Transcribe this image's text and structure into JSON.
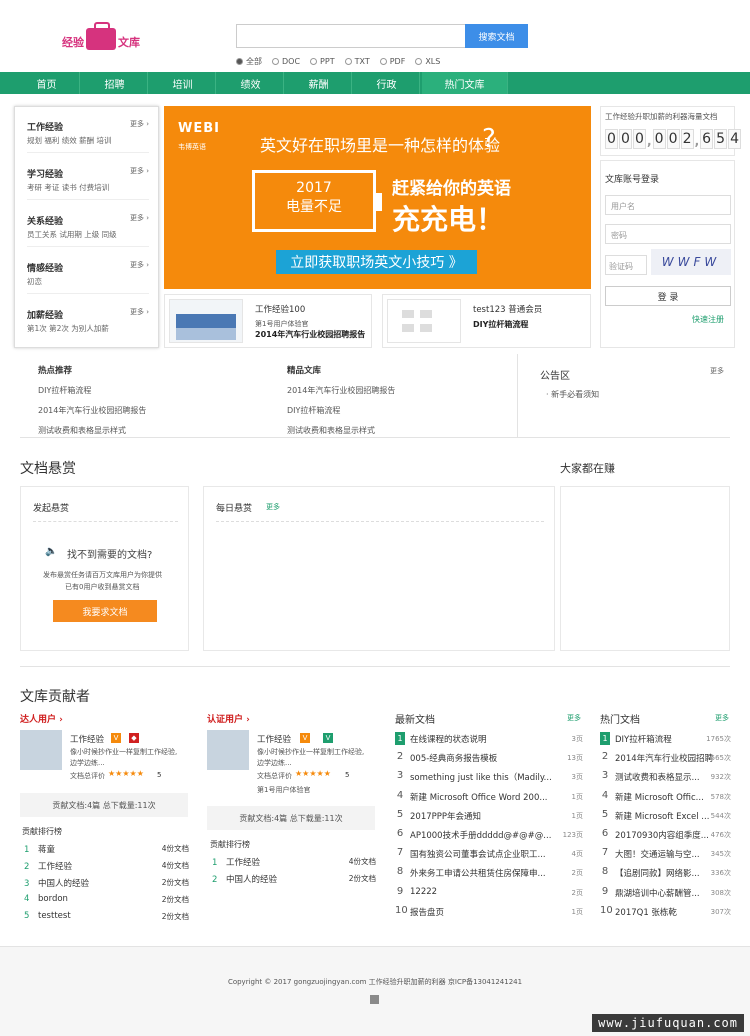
{
  "header": {
    "logo_left": "经验",
    "logo_right": "文库",
    "search_placeholder": "",
    "search_button": "搜索文档",
    "filters": [
      "全部",
      "DOC",
      "PPT",
      "TXT",
      "PDF",
      "XLS"
    ]
  },
  "nav": [
    "首页",
    "招聘",
    "培训",
    "绩效",
    "薪酬",
    "行政",
    "热门文库"
  ],
  "categories": [
    {
      "title": "工作经验",
      "more": "更多 ›",
      "links": "规划  福利  绩效  薪酬  培训"
    },
    {
      "title": "学习经验",
      "more": "更多 ›",
      "links": "考研  考证  读书  付费培训"
    },
    {
      "title": "关系经验",
      "more": "更多 ›",
      "links": "员工关系  试用期  上级  同级"
    },
    {
      "title": "情感经验",
      "more": "更多 ›",
      "links": "初恋"
    },
    {
      "title": "加薪经验",
      "more": "更多 ›",
      "links": "第1次  第2次  为别人加薪"
    }
  ],
  "banner": {
    "brand": "WEBI",
    "brand_sub": "韦博英语",
    "title": "英文好在职场里是一种怎样的体验",
    "year": "2017",
    "battery": "电量不足",
    "copy1": "赶紧给你的英语",
    "copy2": "充充电！",
    "cta": "立即获取职场英文小技巧 》"
  },
  "doc_cards": [
    {
      "user": "工作经验100",
      "desc": "第1号用户体验官",
      "title": "2014年汽车行业校园招聘报告"
    },
    {
      "user": "test123   普通会员",
      "desc": "",
      "title": "DIY拉杆箱流程"
    }
  ],
  "counter": {
    "label": "工作经验升职加薪的利器海量文档",
    "digits": [
      "0",
      "0",
      "0",
      "0",
      "0",
      "2",
      "6",
      "5",
      "4"
    ]
  },
  "login": {
    "title": "文库账号登录",
    "user_ph": "用户名",
    "pass_ph": "密码",
    "captcha_ph": "验证码",
    "captcha": "WWFW",
    "button": "登 录",
    "register": "快速注册"
  },
  "highlights": {
    "hot_title": "热点推荐",
    "hot": [
      "DIY拉杆箱流程",
      "2014年汽车行业校园招聘报告",
      "测试收费和表格显示样式"
    ],
    "best_title": "精品文库",
    "best": [
      "2014年汽车行业校园招聘报告",
      "DIY拉杆箱流程",
      "测试收费和表格显示样式"
    ],
    "notice_title": "公告区",
    "notice_more": "更多",
    "notice": "· 新手必看须知"
  },
  "bounty": {
    "title": "文档悬赏",
    "everyone": "大家都在赚",
    "post_title": "发起悬赏",
    "not_found": "找不到需要的文档?",
    "desc1": "发布悬赏任务请百万文库用户为你提供",
    "desc2": "已有0用户收到悬赏文档",
    "button": "我要求文档",
    "daily": "每日悬赏",
    "daily_more": "更多"
  },
  "contrib": {
    "title": "文库贡献者",
    "expert": {
      "tab": "达人用户 ›",
      "name": "工作经验",
      "bio1": "像小时候抄作业一样复制工作经验,",
      "bio2": "边学边练...",
      "rating_label": "文档总评价",
      "stars": "★★★★★",
      "rating": "5",
      "stats": "贡献文档:4篇   总下载量:11次",
      "rank_title": "贡献排行榜",
      "rank": [
        {
          "n": "1",
          "name": "蒋童",
          "v": "4份文档"
        },
        {
          "n": "2",
          "name": "工作经验",
          "v": "4份文档"
        },
        {
          "n": "3",
          "name": "中国人的经验",
          "v": "2份文档"
        },
        {
          "n": "4",
          "name": "bordon",
          "v": "2份文档"
        },
        {
          "n": "5",
          "name": "testtest",
          "v": "2份文档"
        }
      ]
    },
    "verified": {
      "tab": "认证用户 ›",
      "name": "工作经验",
      "bio1": "像小时候抄作业一样复制工作经验,",
      "bio2": "边学边练...",
      "rating_label": "文档总评价",
      "stars": "★★★★★",
      "rating": "5",
      "extra": "第1号用户体验官",
      "stats": "贡献文档:4篇   总下载量:11次",
      "rank_title": "贡献排行榜",
      "rank": [
        {
          "n": "1",
          "name": "工作经验",
          "v": "4份文档"
        },
        {
          "n": "2",
          "name": "中国人的经验",
          "v": "2份文档"
        }
      ]
    }
  },
  "latest": {
    "title": "最新文档",
    "more": "更多",
    "items": [
      {
        "n": "1",
        "t": "在线课程的状态说明",
        "v": "3页"
      },
      {
        "n": "2",
        "t": "005-经典商务报告模板",
        "v": "13页"
      },
      {
        "n": "3",
        "t": "something just like this（Madily...",
        "v": "3页"
      },
      {
        "n": "4",
        "t": "新建 Microsoft Office Word 200...",
        "v": "1页"
      },
      {
        "n": "5",
        "t": "2017PPP年会通知",
        "v": "1页"
      },
      {
        "n": "6",
        "t": "AP1000技术手册ddddd@#@#@...",
        "v": "123页"
      },
      {
        "n": "7",
        "t": "国有独资公司董事会试点企业职工...",
        "v": "4页"
      },
      {
        "n": "8",
        "t": "外来务工申请公共租赁住房保障申...",
        "v": "2页"
      },
      {
        "n": "9",
        "t": "12222",
        "v": "2页"
      },
      {
        "n": "10",
        "t": "报告盘页",
        "v": "1页"
      }
    ]
  },
  "hot": {
    "title": "热门文档",
    "more": "更多",
    "items": [
      {
        "n": "1",
        "t": "DIY拉杆箱流程",
        "v": "1765次"
      },
      {
        "n": "2",
        "t": "2014年汽车行业校园招聘",
        "v": "565次"
      },
      {
        "n": "3",
        "t": "测试收费和表格显示...",
        "v": "932次"
      },
      {
        "n": "4",
        "t": "新建 Microsoft Offic...",
        "v": "578次"
      },
      {
        "n": "5",
        "t": "新建 Microsoft Excel ...",
        "v": "544次"
      },
      {
        "n": "6",
        "t": "20170930内容组季度...",
        "v": "476次"
      },
      {
        "n": "7",
        "t": "大图！交通运输与空...",
        "v": "345次"
      },
      {
        "n": "8",
        "t": "【追剧同款】网络影...",
        "v": "336次"
      },
      {
        "n": "9",
        "t": "鼎湖培训中心薪酬管...",
        "v": "308次"
      },
      {
        "n": "10",
        "t": "2017Q1 张栋乾",
        "v": "307次"
      }
    ]
  },
  "footer": {
    "copyright": "Copyright © 2017 gongzuojingyan.com 工作经验升职加薪的利器 京ICP备13041241241",
    "watermark": "www.jiufuquan.com"
  },
  "colors": {
    "green": "#1e9e6e",
    "orange": "#f58a0c",
    "blue": "#3d8ee8",
    "pink": "#d6337e"
  }
}
